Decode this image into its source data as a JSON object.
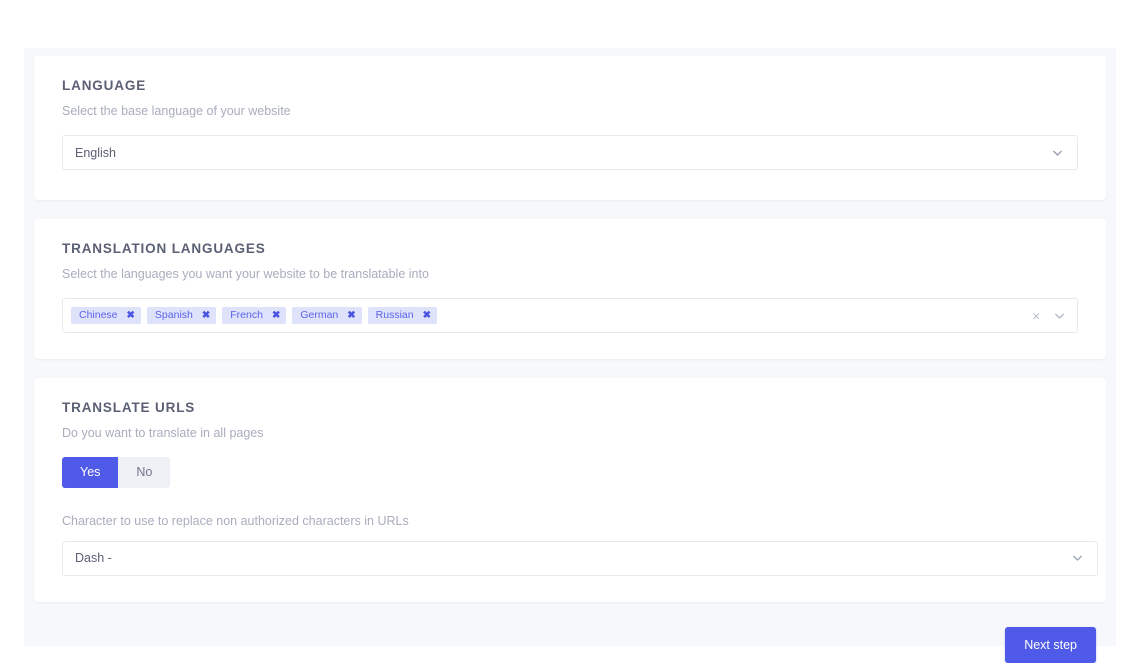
{
  "cards": {
    "language": {
      "title": "LANGUAGE",
      "subtitle": "Select the base language of your website",
      "select": {
        "value": "English",
        "chevron_icon": "chevron-down-icon"
      }
    },
    "translation_languages": {
      "title": "TRANSLATION LANGUAGES",
      "subtitle": "Select the languages you want your website to be translatable into",
      "tags": [
        {
          "label": "Chinese",
          "remove_icon": "✖"
        },
        {
          "label": "Spanish",
          "remove_icon": "✖"
        },
        {
          "label": "French",
          "remove_icon": "✖"
        },
        {
          "label": "German",
          "remove_icon": "✖"
        },
        {
          "label": "Russian",
          "remove_icon": "✖"
        }
      ],
      "clear_icon": "×",
      "chevron_icon": "chevron-down-icon"
    },
    "translate_urls": {
      "title": "TRANSLATE URLS",
      "subtitle": "Do you want to translate in all pages",
      "toggle": {
        "yes_label": "Yes",
        "no_label": "No",
        "selected": "Yes"
      },
      "char_label": "Character to use to replace non authorized characters in URLs",
      "char_select": {
        "value": "Dash -",
        "chevron_icon": "chevron-down-icon"
      }
    }
  },
  "footer": {
    "next_label": "Next step"
  },
  "colors": {
    "accent": "#4f5be8",
    "tag_bg": "#dfe2fb",
    "tag_text": "#5b63e8",
    "page_bg": "#f7f8fb",
    "card_bg": "#ffffff",
    "title_text": "#5b6075",
    "muted_text": "#a9adbd"
  }
}
